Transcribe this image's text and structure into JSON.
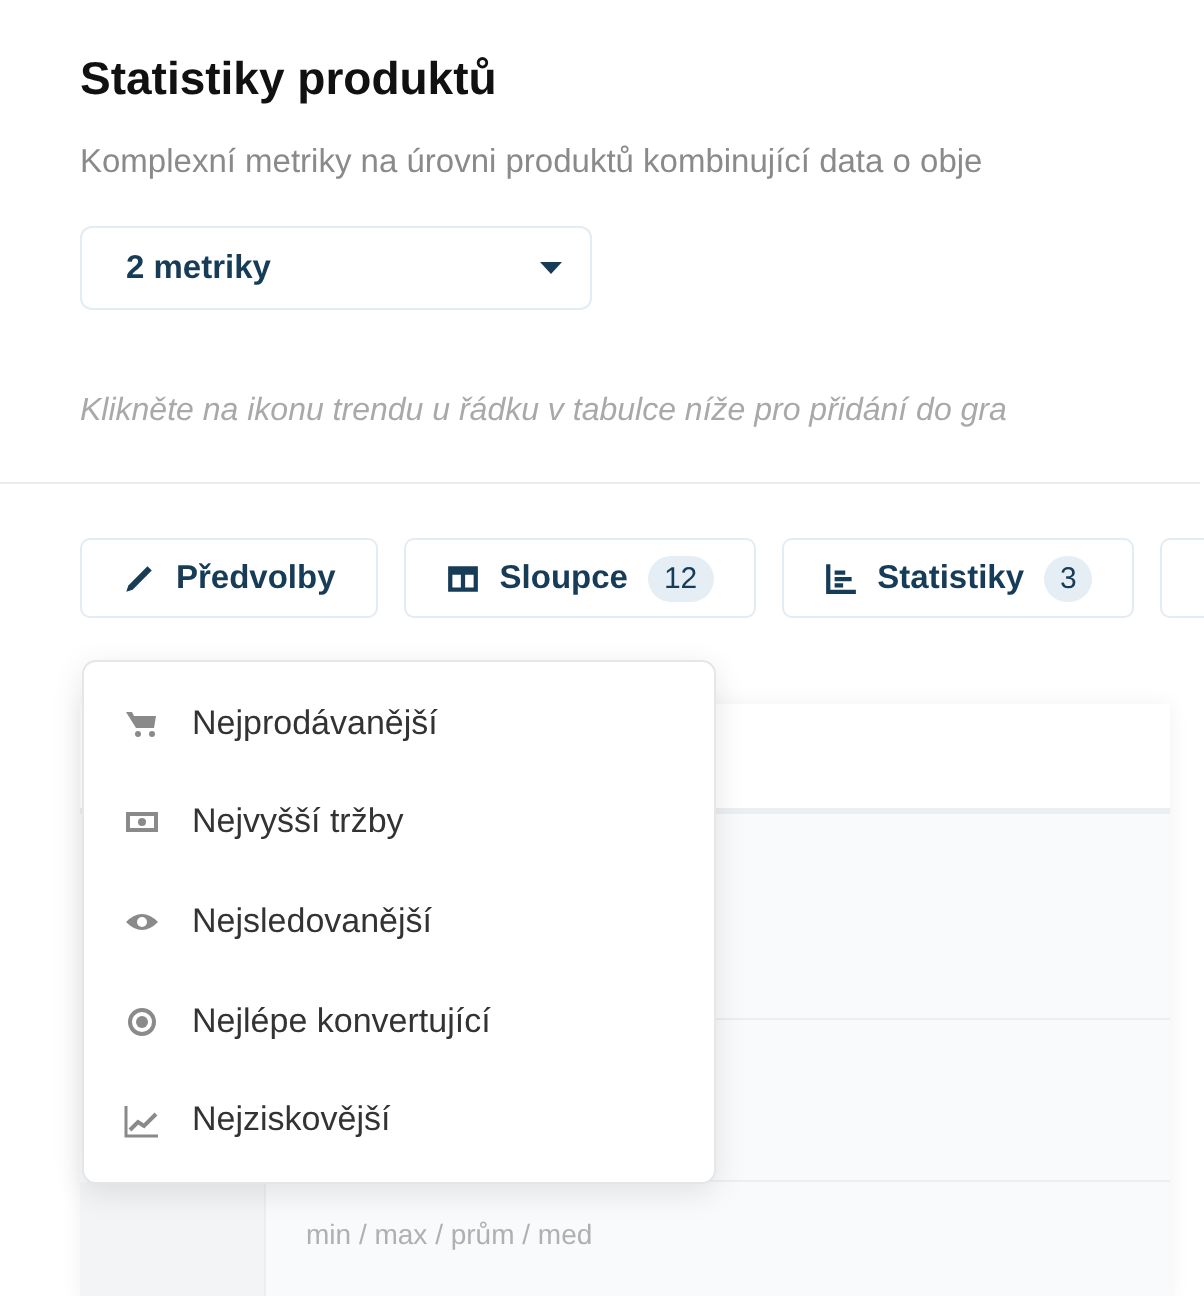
{
  "page": {
    "title": "Statistiky produktů",
    "subtitle": "Komplexní metriky na úrovni produktů kombinující data o obje"
  },
  "metrics_dropdown": {
    "value": "2 metriky"
  },
  "hint": "Klikněte na ikonu trendu u řádku v tabulce níže pro přidání do gra",
  "toolbar": [
    {
      "kind": "pencil",
      "label": "Předvolby"
    },
    {
      "kind": "columns",
      "label": "Sloupce",
      "count": "12"
    },
    {
      "kind": "stats",
      "label": "Statistiky",
      "count": "3"
    },
    {
      "kind": "cut"
    }
  ],
  "presets_menu": [
    {
      "kind": "cart",
      "label": "Nejprodávanější"
    },
    {
      "kind": "money",
      "label": "Nejvyšší tržby"
    },
    {
      "kind": "eye",
      "label": "Nejsledovanější"
    },
    {
      "kind": "target",
      "label": "Nejlépe konvertující"
    },
    {
      "kind": "trend",
      "label": "Nejziskovější"
    }
  ],
  "table": {
    "footer_note": "min / max / prům / med"
  }
}
